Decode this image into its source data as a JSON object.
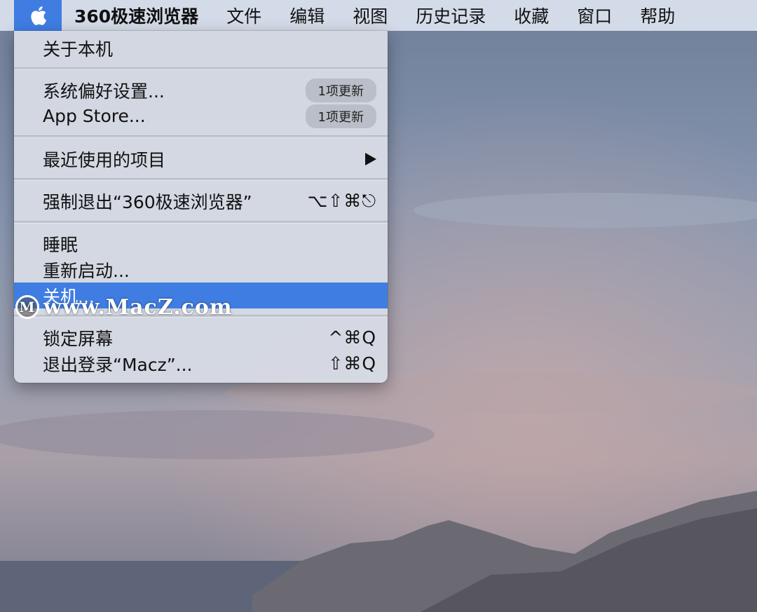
{
  "menubar": {
    "apple_icon": "apple-logo-icon",
    "app_name": "360极速浏览器",
    "items": [
      "文件",
      "编辑",
      "视图",
      "历史记录",
      "收藏",
      "窗口",
      "帮助"
    ]
  },
  "apple_menu": {
    "about": "关于本机",
    "system_prefs": {
      "label": "系统偏好设置...",
      "badge": "1项更新"
    },
    "app_store": {
      "label": "App Store...",
      "badge": "1项更新"
    },
    "recent_items": {
      "label": "最近使用的项目",
      "icon": "submenu-arrow-icon"
    },
    "force_quit": {
      "label": "强制退出“360极速浏览器”",
      "shortcut": "⌥⇧⌘⎋"
    },
    "sleep": "睡眠",
    "restart": "重新启动...",
    "shutdown": "关机...",
    "lock_screen": {
      "label": "锁定屏幕",
      "shortcut": "^⌘Q"
    },
    "logout": {
      "label": "退出登录“Macz”...",
      "shortcut": "⇧⌘Q"
    }
  },
  "watermark": {
    "logo_letter": "M",
    "text": "www.MacZ.com"
  },
  "colors": {
    "accent": "#3f7de3",
    "menu_bg": "#d6dbe4",
    "menubar_bg": "#dce2ee"
  }
}
